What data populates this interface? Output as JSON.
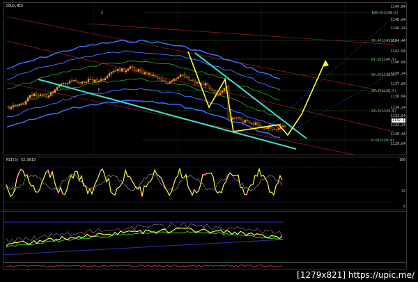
{
  "main_chart": {
    "title": "GOLD,M15",
    "price_axis": [
      "1149.84",
      "1148.04",
      "1146.24",
      "1144.44",
      "1142.64",
      "1140.84",
      "1139.24",
      "1137.84",
      "1136.04",
      "1134.24",
      "1133.64",
      "1132.24",
      "1130.44",
      "1129.64"
    ],
    "current_price": "1132.1",
    "fib_labels": [
      "100.0(1148.0)",
      "76.4(1143.6)",
      "61.8(1140.9)",
      "50.0(1138.6)",
      "38.2(1136.5)",
      "23.6(1133.8)",
      "0.0(1129.4)"
    ],
    "colors": {
      "bull": "#f0a020",
      "bear": "#ff8c00",
      "trend": "#40e0d0",
      "zigzag": "#ffff33",
      "bands": "#3d6fff",
      "green_band": "#2ea82e"
    }
  },
  "rsi_pane": {
    "title": "RSI(5) 52.8619",
    "axis": [
      "100",
      "32",
      "6"
    ]
  },
  "osc_pane": {
    "title": ""
  },
  "watermark": "[1279x821] https://upic.me/"
}
